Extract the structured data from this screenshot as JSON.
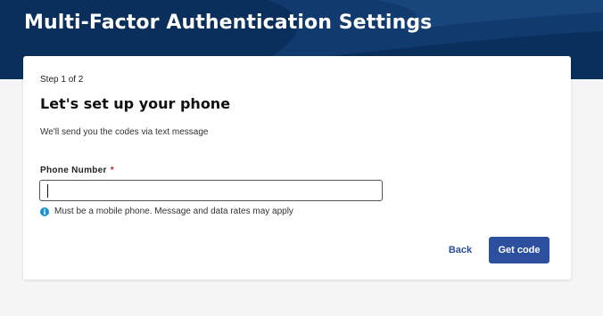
{
  "header": {
    "title": "Multi-Factor Authentication Settings",
    "background_color": "#0a2f5c"
  },
  "card": {
    "step": "Step 1 of 2",
    "heading": "Let's set up your phone",
    "subtext": "We'll send you the codes via text message",
    "phone_field": {
      "label": "Phone Number",
      "required_marker": "*",
      "value": "",
      "hint": "Must be a mobile phone. Message and data rates may apply",
      "hint_icon": "info-icon"
    },
    "actions": {
      "back_label": "Back",
      "primary_label": "Get code",
      "primary_color": "#2c4f9e"
    }
  }
}
